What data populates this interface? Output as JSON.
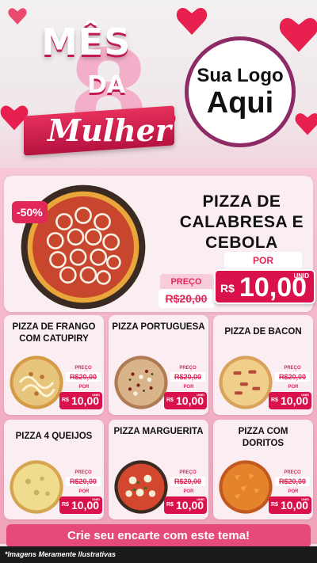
{
  "header": {
    "title_mes": "MÊS",
    "title_da": "DA",
    "title_mulher": "Mulher",
    "logo_line1": "Sua Logo",
    "logo_line2": "Aqui",
    "accent_color": "#d9124b"
  },
  "featured": {
    "name": "PIZZA DE CALABRESA E CEBOLA",
    "discount": "-50%",
    "price_label": "PREÇO",
    "old_price": "R$20,00",
    "por_label": "POR",
    "currency": "R$",
    "new_price": "10,00",
    "unit": "UNID"
  },
  "products": [
    {
      "name": "PIZZA DE FRANGO COM CATUPIRY",
      "price_label": "PREÇO",
      "old_price": "R$20,00",
      "por_label": "POR",
      "currency": "R$",
      "new_price": "10,00",
      "unit": "UNID"
    },
    {
      "name": "PIZZA PORTUGUESA",
      "price_label": "PREÇO",
      "old_price": "R$20,00",
      "por_label": "POR",
      "currency": "R$",
      "new_price": "10,00",
      "unit": "UNID"
    },
    {
      "name": "PIZZA DE BACON",
      "price_label": "PREÇO",
      "old_price": "R$20,00",
      "por_label": "POR",
      "currency": "R$",
      "new_price": "10,00",
      "unit": "UNID"
    },
    {
      "name": "PIZZA 4 QUEIJOS",
      "price_label": "PREÇO",
      "old_price": "R$20,00",
      "por_label": "POR",
      "currency": "R$",
      "new_price": "10,00",
      "unit": "UNID"
    },
    {
      "name": "PIZZA MARGUERITA",
      "price_label": "PREÇO",
      "old_price": "R$20,00",
      "por_label": "POR",
      "currency": "R$",
      "new_price": "10,00",
      "unit": "UNID"
    },
    {
      "name": "PIZZA COM DORITOS",
      "price_label": "PREÇO",
      "old_price": "R$20,00",
      "por_label": "POR",
      "currency": "R$",
      "new_price": "10,00",
      "unit": "UNID"
    }
  ],
  "cta": "Crie seu encarte com este tema!",
  "footer_note": "*Imagens Meramente Ilustrativas"
}
